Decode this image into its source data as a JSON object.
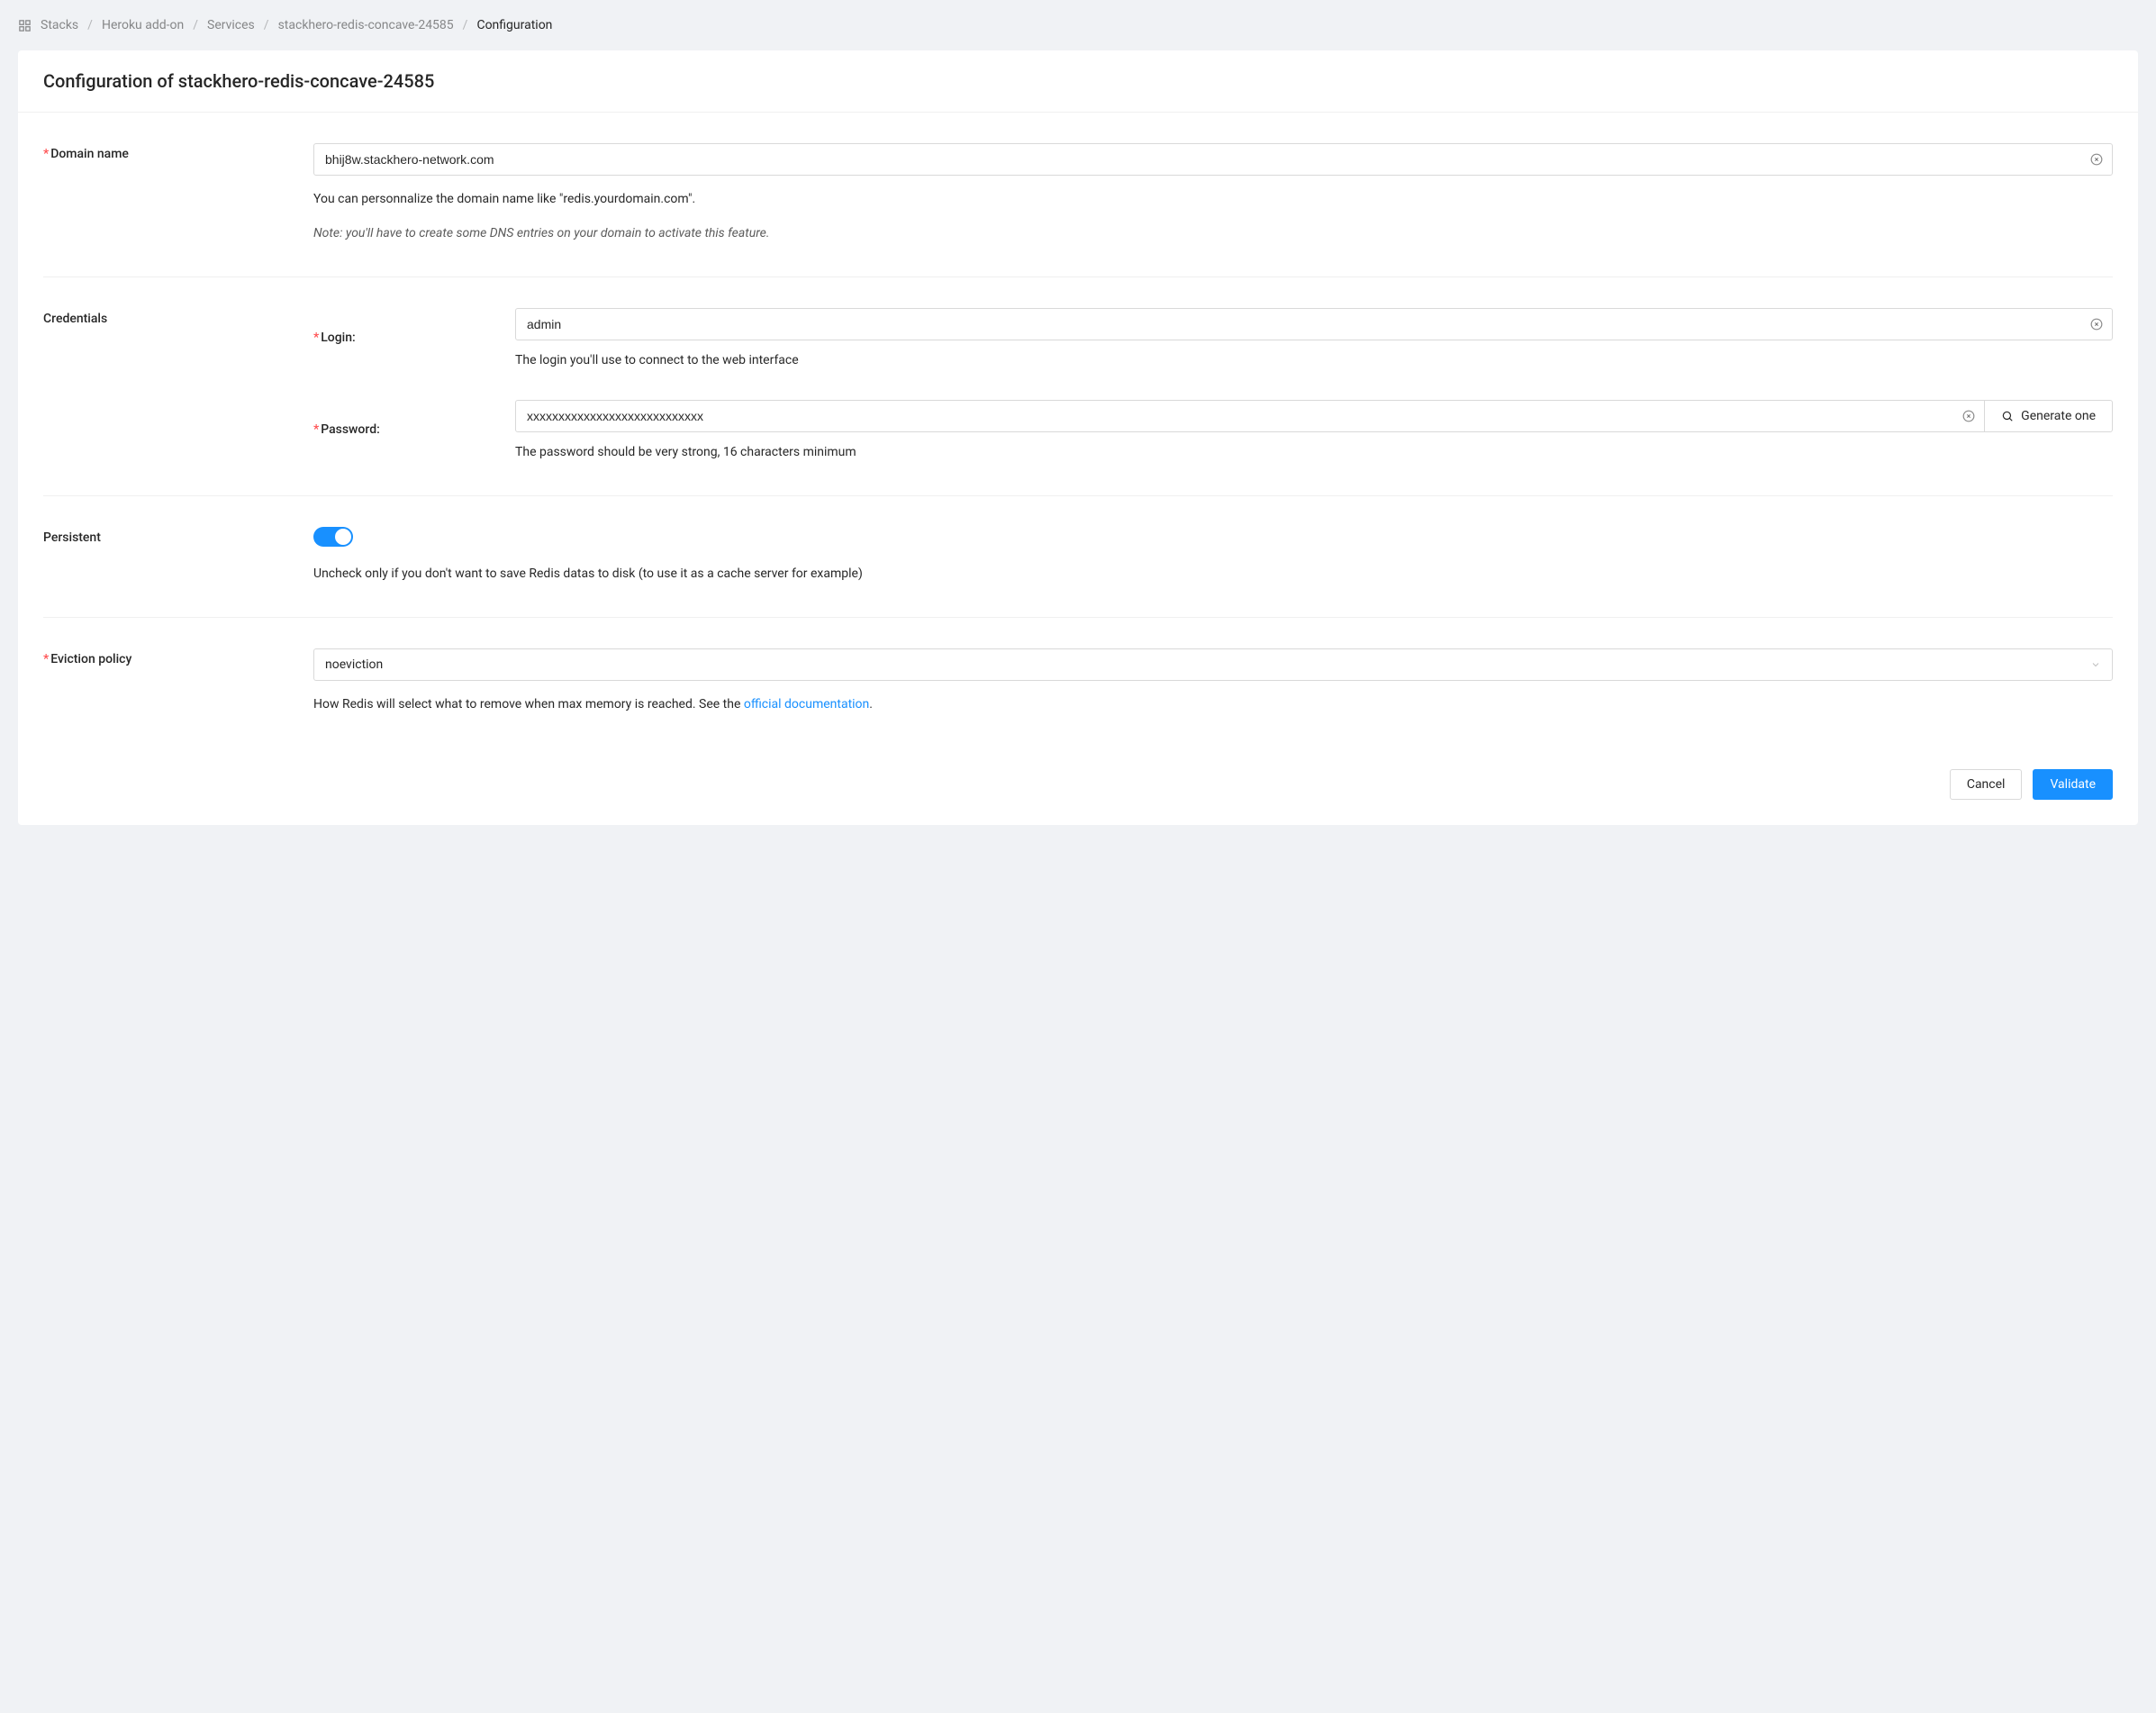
{
  "breadcrumb": {
    "items": [
      "Stacks",
      "Heroku add-on",
      "Services",
      "stackhero-redis-concave-24585"
    ],
    "current": "Configuration"
  },
  "header": {
    "title": "Configuration of stackhero-redis-concave-24585"
  },
  "sections": {
    "domain": {
      "label": "Domain name",
      "value": "bhij8w.stackhero-network.com",
      "helper": "You can personnalize the domain name like \"redis.yourdomain.com\".",
      "note": "Note: you'll have to create some DNS entries on your domain to activate this feature."
    },
    "credentials": {
      "label": "Credentials",
      "login": {
        "label": "Login:",
        "value": "admin",
        "helper": "The login you'll use to connect to the web interface"
      },
      "password": {
        "label": "Password:",
        "value": "xxxxxxxxxxxxxxxxxxxxxxxxxxxx",
        "generate_label": "Generate one",
        "helper": "The password should be very strong, 16 characters minimum"
      }
    },
    "persistent": {
      "label": "Persistent",
      "on": true,
      "helper": "Uncheck only if you don't want to save Redis datas to disk (to use it as a cache server for example)"
    },
    "eviction": {
      "label": "Eviction policy",
      "value": "noeviction",
      "helper_prefix": "How Redis will select what to remove when max memory is reached. See the ",
      "helper_link": "official documentation",
      "helper_suffix": "."
    }
  },
  "footer": {
    "cancel": "Cancel",
    "validate": "Validate"
  }
}
